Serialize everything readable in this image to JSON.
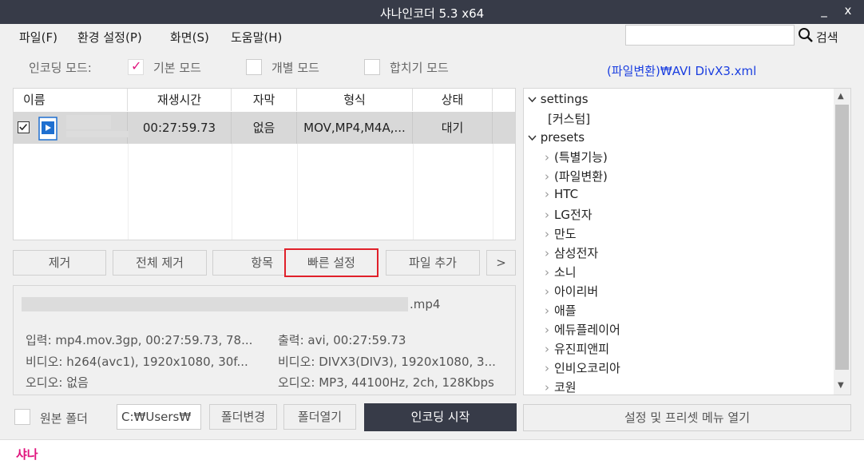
{
  "titlebar": {
    "title": "샤나인코더  5.3  x64",
    "minimize": "_",
    "close": "x"
  },
  "menu": [
    "파일(F)",
    "환경 설정(P)",
    "화면(S)",
    "도움말(H)"
  ],
  "search": {
    "value": "",
    "label": "검색"
  },
  "mode": {
    "label": "인코딩 모드:",
    "basic": "기본 모드",
    "individual": "개별 모드",
    "merge": "합치기 모드",
    "basic_checked_glyph": "✓"
  },
  "preset_path": "(파일변환)₩AVI DivX3.xml",
  "filelist": {
    "columns": [
      "이름",
      "재생시간",
      "자막",
      "형식",
      "상태"
    ],
    "rows": [
      {
        "checked": true,
        "name": "",
        "duration": "00:27:59.73",
        "subtitle": "없음",
        "format": "MOV,MP4,M4A,...",
        "status": "대기"
      }
    ]
  },
  "buttons": {
    "remove": "제거",
    "remove_all": "전체 제거",
    "item": "항목",
    "quick_settings": "빠른 설정",
    "add_file": "파일 추가",
    "more": ">"
  },
  "info": {
    "filename_ext": ".mp4",
    "input": "입력: mp4.mov.3gp, 00:27:59.73, 78...",
    "output": "출력: avi, 00:27:59.73",
    "video_in": "비디오: h264(avc1), 1920x1080, 30f...",
    "video_out": "비디오: DIVX3(DIV3), 1920x1080, 3...",
    "audio_in": "오디오: 없음",
    "audio_out": "오디오: MP3, 44100Hz, 2ch, 128Kbps"
  },
  "tree": {
    "settings_label": "settings",
    "custom_label": "[커스텀]",
    "presets_label": "presets",
    "preset_items": [
      "(특별기능)",
      "(파일변환)",
      "HTC",
      "LG전자",
      "만도",
      "삼성전자",
      "소니",
      "아이리버",
      "애플",
      "에듀플레이어",
      "유진피앤피",
      "인비오코리아",
      "코원"
    ]
  },
  "bottom": {
    "original_folder": "원본 폴더",
    "folder_path": "C:₩Users₩",
    "change_folder": "폴더변경",
    "open_folder": "폴더열기",
    "start_encoding": "인코딩 시작",
    "open_settings_menu": "설정 및 프리셋 메뉴 열기"
  },
  "status": {
    "text": "샤나"
  },
  "colors": {
    "titlebar": "#373b48",
    "highlight": "#e0202a",
    "link": "#1a3ee0",
    "brand": "#e0147d",
    "check": "#e0147d"
  }
}
